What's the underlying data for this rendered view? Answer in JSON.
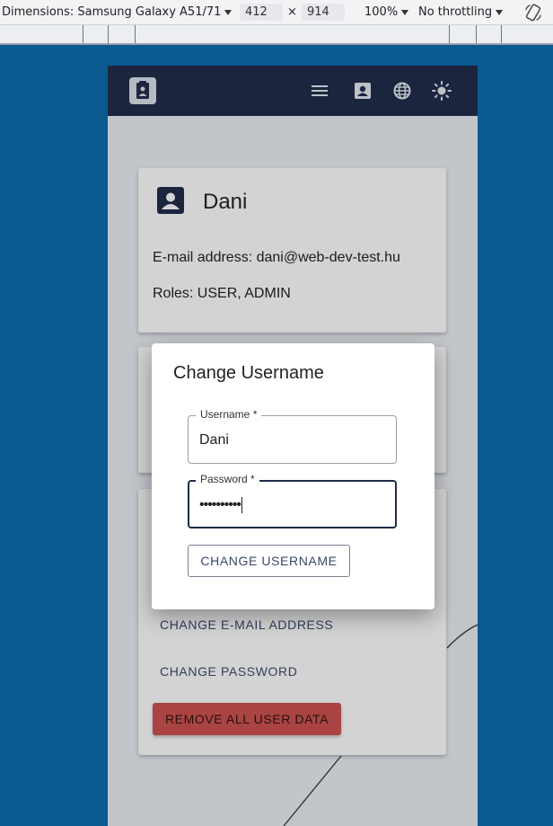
{
  "devtools": {
    "dimensions_label": "Dimensions: Samsung Galaxy A51/71",
    "width": "412",
    "height": "914",
    "times": "×",
    "zoom": "100%",
    "throttling": "No throttling"
  },
  "app": {
    "appbar": {
      "icons": [
        "logo-icon",
        "menu-icon",
        "account-icon",
        "globe-icon",
        "brightness-icon"
      ]
    },
    "profile_card": {
      "name": "Dani",
      "email_line": "E-mail address: dani@web-dev-test.hu",
      "roles_line": "Roles: USER, ADMIN"
    },
    "actions_card": {
      "change_email": "CHANGE E-MAIL ADDRESS",
      "change_password": "CHANGE PASSWORD",
      "remove_data": "REMOVE ALL USER DATA"
    }
  },
  "dialog": {
    "title": "Change Username",
    "username_label": "Username *",
    "username_value": "Dani",
    "password_label": "Password *",
    "password_value": "••••••••••",
    "submit": "CHANGE USERNAME"
  },
  "colors": {
    "appbar": "#1f2b47",
    "page_bg": "#0a5a8f",
    "danger": "#c24e4c"
  }
}
